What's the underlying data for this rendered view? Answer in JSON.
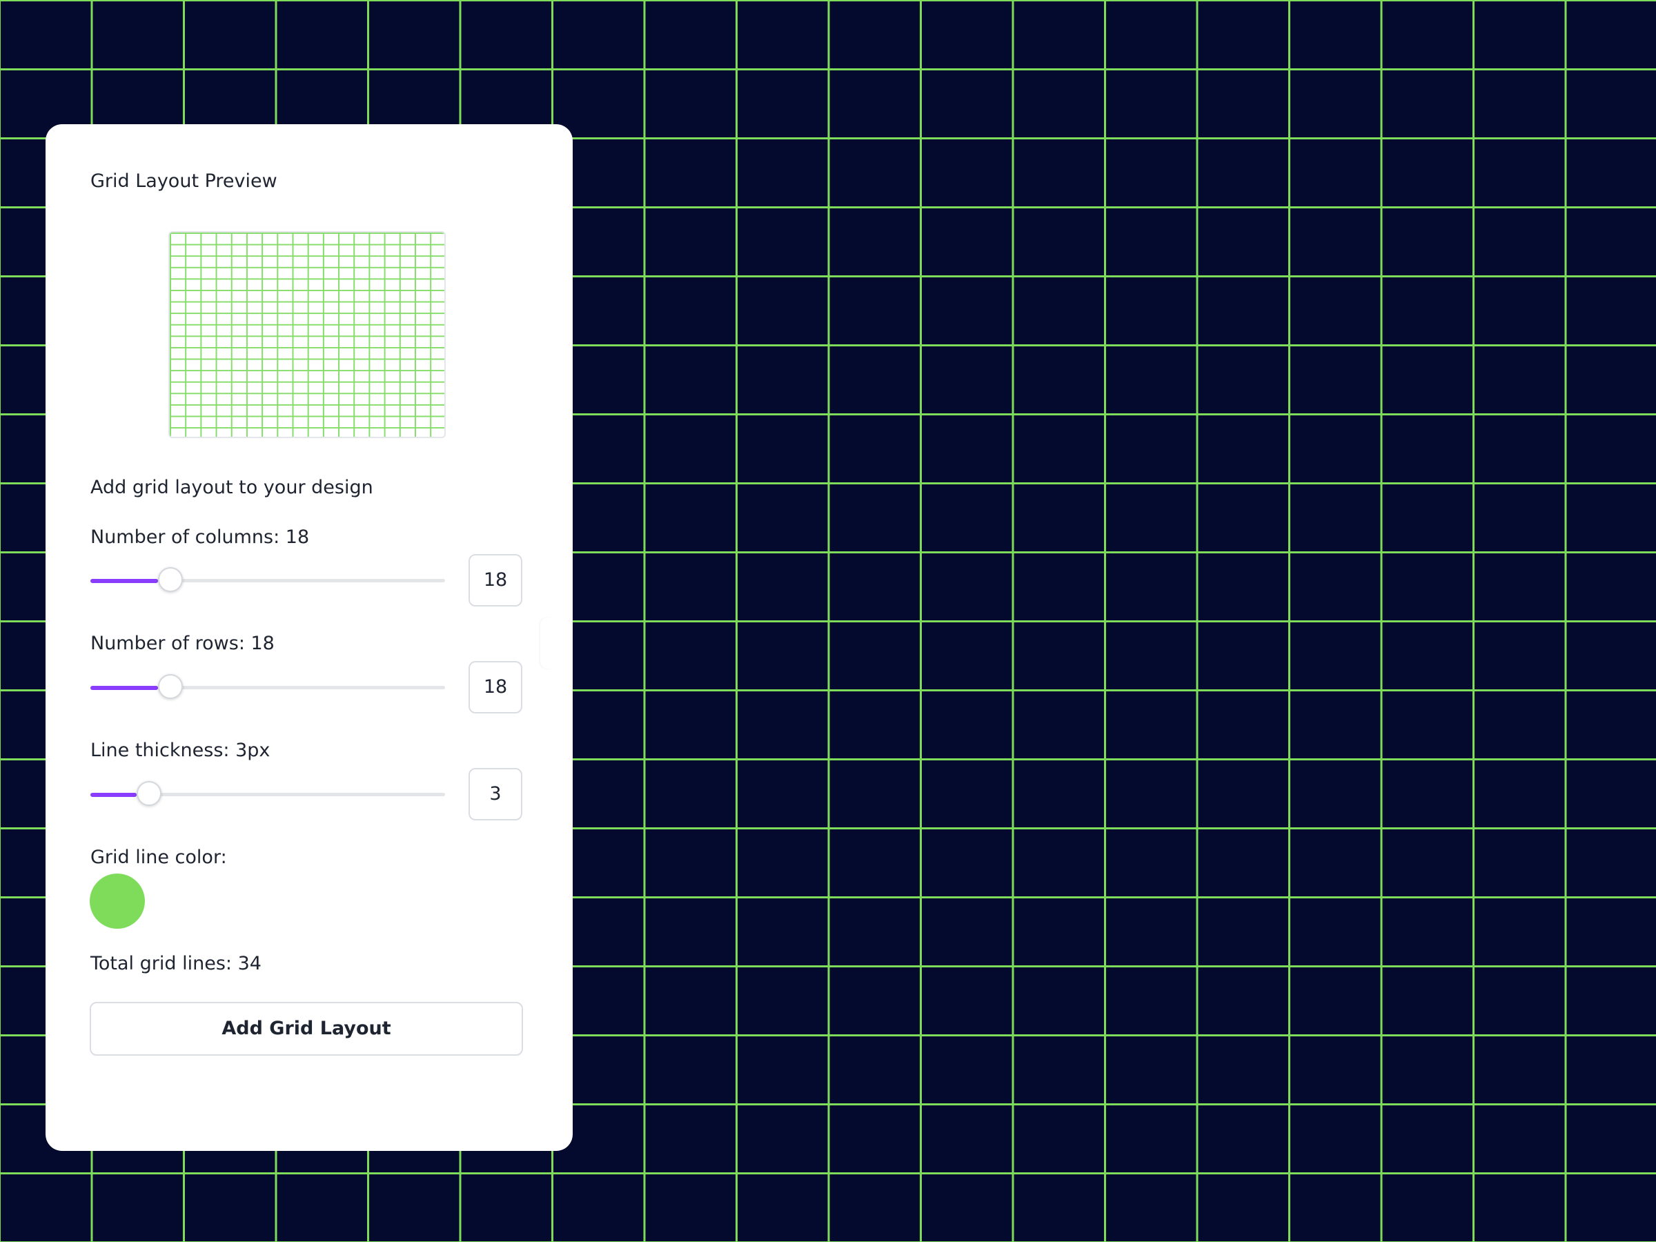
{
  "panel": {
    "preview_title": "Grid Layout Preview",
    "description": "Add grid layout to your design",
    "columns": {
      "label": "Number of columns: 18",
      "value": "18",
      "slider_fraction": 0.19
    },
    "rows": {
      "label": "Number of rows: 18",
      "value": "18",
      "slider_fraction": 0.19
    },
    "thickness": {
      "label": "Line thickness: 3px",
      "value": "3",
      "slider_fraction": 0.13
    },
    "color_label": "Grid line color:",
    "total_lines": "Total grid lines: 34",
    "add_button_label": "Add Grid Layout"
  },
  "colors": {
    "grid_line": "#7fdc5a",
    "canvas_background": "#030a2d",
    "slider_accent": "#8b3dff",
    "swatch": "#7fdc5a"
  }
}
